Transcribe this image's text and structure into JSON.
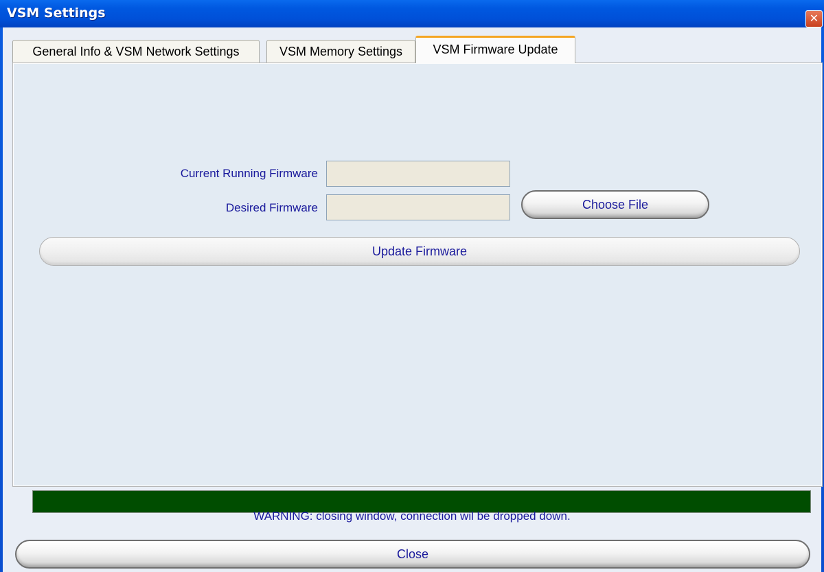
{
  "window": {
    "title": "VSM Settings",
    "close_glyph": "✕"
  },
  "tabs": [
    {
      "label": "General Info & VSM Network Settings",
      "active": false
    },
    {
      "label": "VSM Memory Settings",
      "active": false
    },
    {
      "label": "VSM Firmware Update",
      "active": true
    }
  ],
  "firmware": {
    "current_label": "Current Running Firmware",
    "current_value": "",
    "desired_label": "Desired Firmware",
    "desired_value": "",
    "choose_file_label": "Choose File",
    "update_label": "Update Firmware",
    "progress_fraction": 1.0,
    "progress_color": "#004d00"
  },
  "footer": {
    "warning": "WARNING: closing window, connection wil be dropped down.",
    "close_label": "Close"
  },
  "colors": {
    "title_bar": "#0058e0",
    "text_blue": "#1a1a9c",
    "active_tab_accent": "#f5a623"
  }
}
